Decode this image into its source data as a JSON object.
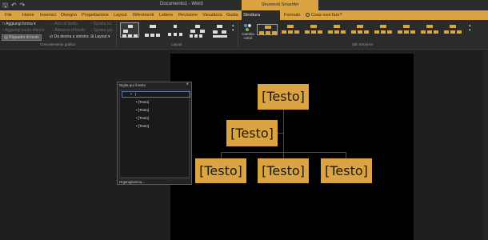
{
  "window": {
    "title": "Documento1 - Word",
    "contextual_title": "Strumenti SmartArt"
  },
  "qat": {
    "save": "🖫",
    "undo": "↶",
    "redo": "↷"
  },
  "tabs": [
    {
      "label": "File"
    },
    {
      "label": "Home"
    },
    {
      "label": "Inserisci"
    },
    {
      "label": "Disegno"
    },
    {
      "label": "Progettazione"
    },
    {
      "label": "Layout"
    },
    {
      "label": "Riferimenti"
    },
    {
      "label": "Lettere"
    },
    {
      "label": "Revisione"
    },
    {
      "label": "Visualizza"
    },
    {
      "label": "Guida"
    },
    {
      "label": "Struttura SmartArt"
    },
    {
      "label": "Formato"
    }
  ],
  "tell_me": "Cosa vuoi fare?",
  "ribbon": {
    "add_shape": "Aggiungi forma",
    "add_bullet": "Aggiungi punto elenco",
    "text_pane": "Riquadro di testo",
    "promote": "Alza di livello",
    "demote": "Abbassa di livello",
    "right_to_left": "Da destra a sinistra",
    "move_up": "Sposta su",
    "move_down": "Sposta giù",
    "layout_btn": "Layout",
    "change_colors": "Cambia colori",
    "groups": {
      "create": "Crea elemento grafico",
      "layouts": "Layout",
      "styles": "Stili SmartArt"
    }
  },
  "text_pane": {
    "title": "Digita qui il testo",
    "close": "×",
    "items": [
      "[Testo]",
      "[Testo]",
      "[Testo]",
      "[Testo]"
    ],
    "footer": "Organigramma..."
  },
  "diagram": {
    "top": "[Testo]",
    "assistant": "[Testo]",
    "children": [
      "[Testo]",
      "[Testo]",
      "[Testo]"
    ]
  },
  "colors": {
    "accent": "#d9a441",
    "dark_bg": "#2b2b2b",
    "page": "#000000"
  }
}
